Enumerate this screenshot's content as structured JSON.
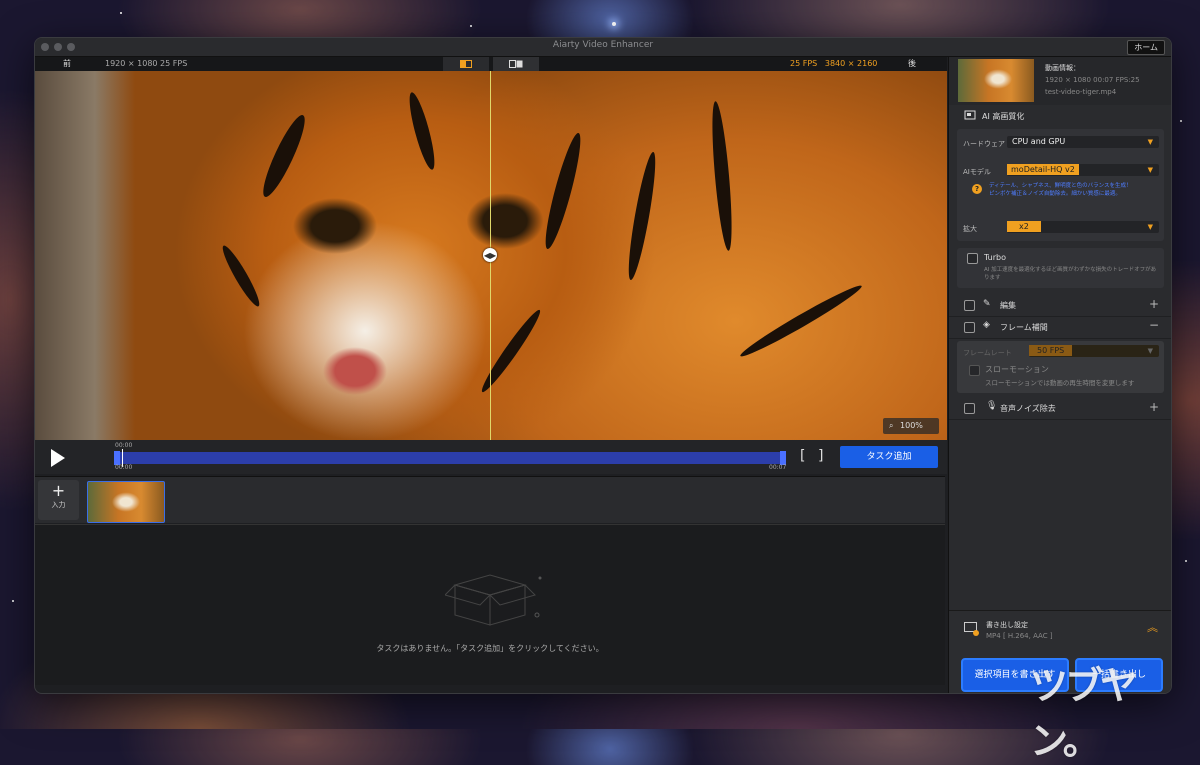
{
  "window": {
    "title": "Aiarty Video Enhancer",
    "home_label": "ホーム"
  },
  "preview": {
    "before_label": "前",
    "before_info": "1920 × 1080   25 FPS",
    "after_fps": "25 FPS",
    "after_res": "3840 × 2160",
    "after_label": "後",
    "zoom": "100%"
  },
  "timeline": {
    "current_time": "00:00",
    "start_time": "00:00",
    "end_time": "00:07",
    "bracket_open": "[",
    "bracket_close": "]",
    "task_add_label": "タスク追加"
  },
  "filmstrip": {
    "input_label": "入力"
  },
  "tasks": {
    "empty_message": "タスクはありません。「タスク追加」をクリックしてください。"
  },
  "sidebar": {
    "info_title": "動画情報：",
    "info_meta": "1920 × 1080  00:07  FPS:25",
    "info_file": "test-video-tiger.mp4",
    "ai_section": "AI 高画質化",
    "hardware_label": "ハードウェア",
    "hardware_value": "CPU and GPU",
    "model_label": "AIモデル",
    "model_value": "moDetail-HQ  v2",
    "model_desc_line1": "ディテール、シャプネス、鮮明度と色のバランスを生成！",
    "model_desc_line2": "ピンボケ補正＆ノイズ自動除去。細かい質感に最適。",
    "upscale_label": "拡大",
    "upscale_value": "x2",
    "turbo_label": "Turbo",
    "turbo_desc_line1": "AI 加工速度を最適化するほど画質がわずかな損失のトレードオフがあ",
    "turbo_desc_line2": "ります",
    "edit_label": "編集",
    "frame_interp_label": "フレーム補間",
    "frame_rate_label": "フレームレート",
    "frame_rate_value": "50 FPS",
    "slowmo_label": "スローモーション",
    "slowmo_desc": "スローモーションでは動画の再生時間を変更します",
    "denoise_label": "音声ノイズ除去",
    "export_title": "書き出し設定",
    "export_format": "MP4 [ H.264, AAC ]",
    "export_selected": "選択項目を書き出す",
    "export_all": "一括書き出し"
  },
  "watermark": "ツブヤン。",
  "colors": {
    "accent_orange": "#f0a020",
    "accent_blue": "#1a5fe6"
  }
}
